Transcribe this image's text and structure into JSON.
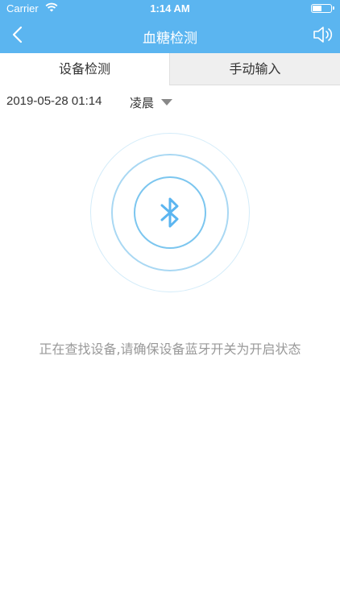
{
  "status_bar": {
    "carrier": "Carrier",
    "time": "1:14 AM"
  },
  "nav": {
    "title": "血糖检测",
    "back_icon": "chevron-left-icon",
    "sound_icon": "speaker-icon"
  },
  "tabs": [
    {
      "label": "设备检测",
      "active": true
    },
    {
      "label": "手动输入",
      "active": false
    }
  ],
  "reading": {
    "datetime": "2019-05-28 01:14",
    "period": "凌晨"
  },
  "device_search": {
    "icon": "bluetooth-icon",
    "message": "正在查找设备,请确保设备蓝牙开关为开启状态"
  },
  "colors": {
    "primary": "#5bb5f0",
    "tab_inactive_bg": "#efefef",
    "message_text": "#999999"
  }
}
